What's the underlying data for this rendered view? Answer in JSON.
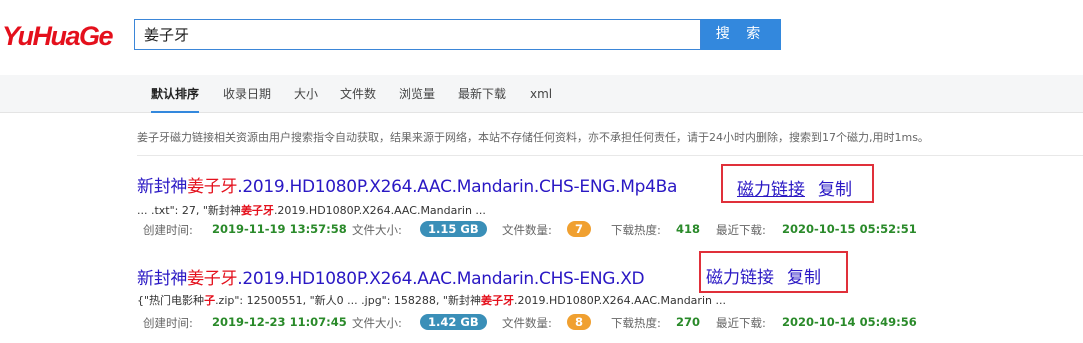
{
  "logo": "YuHuaGe",
  "search": {
    "value": "姜子牙",
    "button": "搜 索"
  },
  "nav": [
    "默认排序",
    "收录日期",
    "大小",
    "文件数",
    "浏览量",
    "最新下载",
    "xml"
  ],
  "notice": "姜子牙磁力链接相关资源由用户搜索指令自动获取，结果来源于网络，本站不存储任何资料，亦不承担任何责任，请于24小时内删除，搜索到17个磁力,用时1ms。",
  "results": [
    {
      "title_pre": "新封神",
      "title_hl": "姜子牙",
      "title_post": ".2019.HD1080P.X264.AAC.Mandarin.CHS-ENG.Mp4Ba",
      "magnet": "磁力链接",
      "copy": "复制",
      "snippet_pre": "... .txt\": 27, \"新封神",
      "snippet_hl": "姜子牙",
      "snippet_post": ".2019.HD1080P.X264.AAC.Mandarin ...",
      "created_label": "创建时间:",
      "created": "2019-11-19 13:57:58",
      "size_label": "文件大小:",
      "size": "1.15 GB",
      "count_label": "文件数量:",
      "count": "7",
      "heat_label": "下载热度:",
      "heat": "418",
      "recent_label": "最近下载:",
      "recent": "2020-10-15 05:52:51"
    },
    {
      "title_pre": "新封神",
      "title_hl": "姜子牙",
      "title_post": ".2019.HD1080P.X264.AAC.Mandarin.CHS-ENG.XD",
      "magnet": "磁力链接",
      "copy": "复制",
      "snippet_pre": "{\"热门电影种",
      "snippet_hl": "子",
      "snippet_mid": ".zip\": 12500551, \"新人0 ... .jpg\": 158288, \"新封神",
      "snippet_hl2": "姜子牙",
      "snippet_post": ".2019.HD1080P.X264.AAC.Mandarin ...",
      "created_label": "创建时间:",
      "created": "2019-12-23 11:07:45",
      "size_label": "文件大小:",
      "size": "1.42 GB",
      "count_label": "文件数量:",
      "count": "8",
      "heat_label": "下载热度:",
      "heat": "270",
      "recent_label": "最近下载:",
      "recent": "2020-10-14 05:49:56"
    }
  ],
  "colors": {
    "accent": "#3388dd",
    "highlight": "#e4101c",
    "link": "#2a18c4",
    "value_green": "#2a8a2a",
    "annotation_box": "#e0303a"
  }
}
